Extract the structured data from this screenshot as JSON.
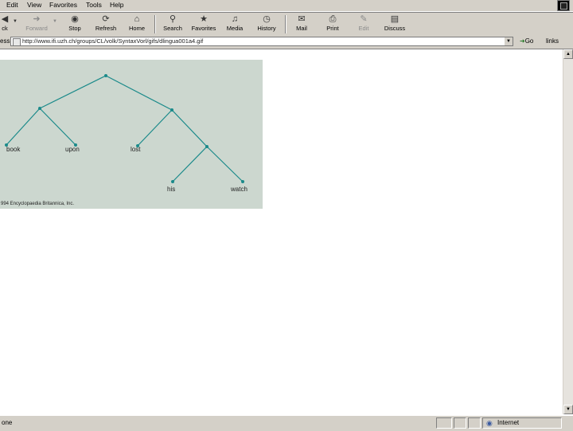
{
  "menu": [
    "Edit",
    "View",
    "Favorites",
    "Tools",
    "Help"
  ],
  "toolbar": {
    "back": "ck",
    "forward": "Forward",
    "stop": "Stop",
    "refresh": "Refresh",
    "home": "Home",
    "search": "Search",
    "favorites": "Favorites",
    "media": "Media",
    "history": "History",
    "mail": "Mail",
    "print": "Print",
    "edit": "Edit",
    "discuss": "Discuss"
  },
  "address": {
    "label": "ess",
    "url": "http://www.ifi.uzh.ch/groups/CL/volk/SyntaxVorl/gifs/dlingua001a4.gif",
    "go": "Go",
    "links": "links"
  },
  "tree_image": {
    "words": [
      "book",
      "upon",
      "lost",
      "his",
      "watch"
    ],
    "copyright": "994 Encyclopaedia Britannica, Inc.",
    "line_color": "#1a8a8a",
    "background": "#ccd7cf"
  },
  "status": {
    "text": "one",
    "zone": "Internet"
  }
}
